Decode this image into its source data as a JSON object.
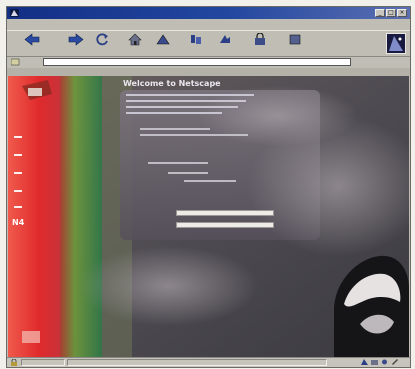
{
  "window": {
    "title": ""
  },
  "menubar": {
    "items": [
      "",
      "",
      "",
      "",
      "",
      "",
      ""
    ]
  },
  "toolbar": {
    "buttons": [
      {
        "icon": "back-icon",
        "label": ""
      },
      {
        "icon": "forward-icon",
        "label": ""
      },
      {
        "icon": "reload-icon",
        "label": ""
      },
      {
        "icon": "home-icon",
        "label": ""
      },
      {
        "icon": "search-icon",
        "label": ""
      },
      {
        "icon": "guide-icon",
        "label": ""
      },
      {
        "icon": "print-icon",
        "label": ""
      },
      {
        "icon": "security-icon",
        "label": ""
      },
      {
        "icon": "stop-icon",
        "label": ""
      }
    ]
  },
  "location": {
    "label": "",
    "url": "",
    "related_label": ""
  },
  "bookmarks": {
    "items": [
      "",
      "",
      "",
      "",
      "",
      "",
      "",
      ""
    ]
  },
  "page": {
    "heading": "Welcome to Netscape"
  },
  "sidebar": {
    "badge": "N4"
  },
  "status": {
    "text": "",
    "info": ""
  },
  "colors": {
    "title_bar": "#23479f",
    "chrome": "#bfbdb4",
    "sidebar_red": "#e02a2c",
    "page_bg": "#4f4a4e",
    "banner_green": "#3f9a3d"
  }
}
